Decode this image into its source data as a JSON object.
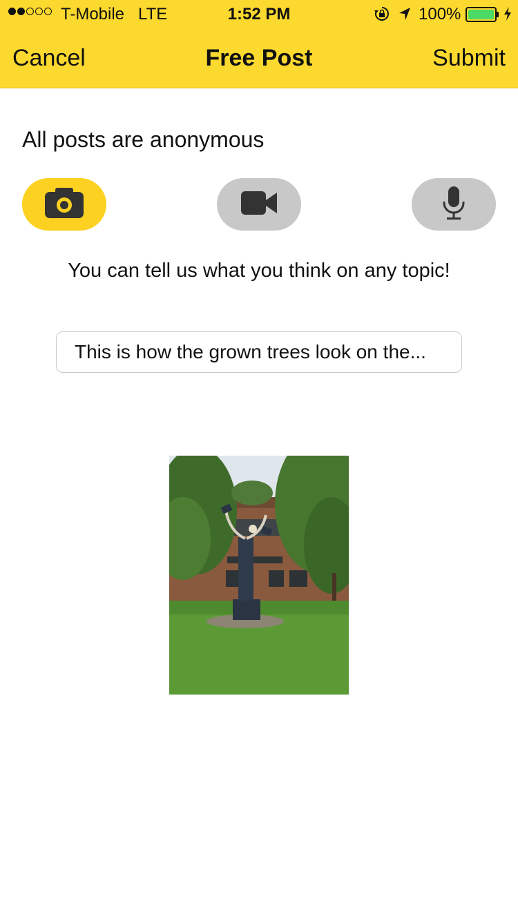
{
  "status_bar": {
    "signal_bars_filled": 2,
    "signal_bars_total": 5,
    "carrier": "T-Mobile",
    "network": "LTE",
    "time": "1:52 PM",
    "battery_percent": "100%",
    "battery_level": 1.0,
    "icons": [
      "rotation-lock-icon",
      "location-arrow-icon",
      "battery-icon",
      "charging-bolt-icon"
    ]
  },
  "nav": {
    "cancel_label": "Cancel",
    "title": "Free Post",
    "submit_label": "Submit"
  },
  "anonymous_notice": "All posts are anonymous",
  "media_buttons": [
    {
      "icon": "camera-icon",
      "state": "selected"
    },
    {
      "icon": "video-camera-icon",
      "state": "unselected"
    },
    {
      "icon": "microphone-icon",
      "state": "unselected"
    }
  ],
  "prompt": "You can tell us what you think on any topic!",
  "caption": {
    "value": "This is how the grown trees look on the..."
  },
  "attached_photo": {
    "icon": "attached-photo"
  },
  "colors": {
    "header_background": "#fcd92e",
    "active_button": "#fcd121",
    "inactive_button": "#c8c8c8",
    "battery_fill": "#4cd964"
  }
}
